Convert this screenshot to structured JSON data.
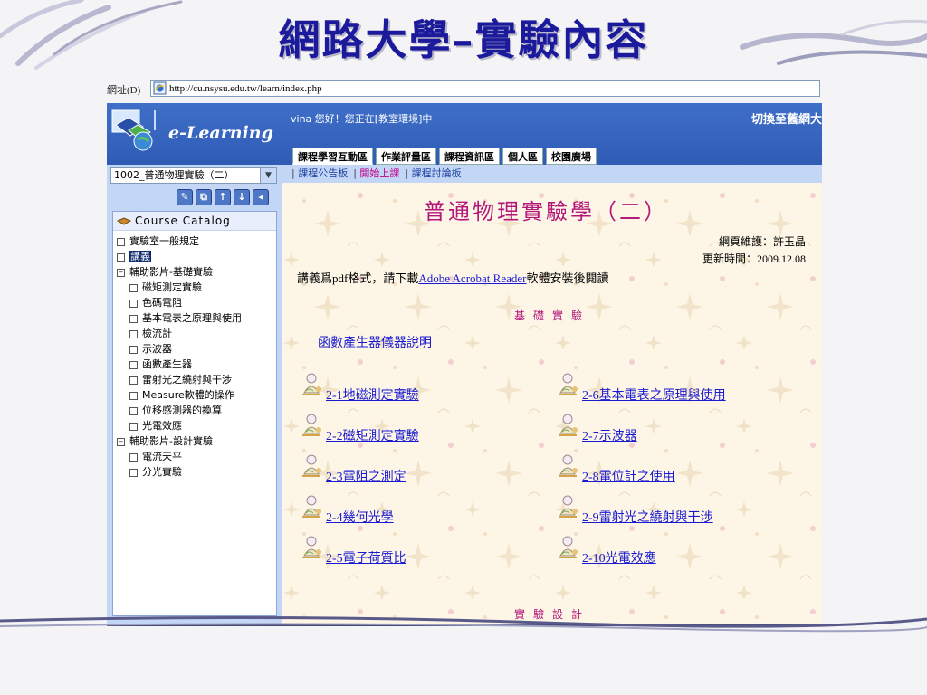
{
  "slide": {
    "title": "網路大學–實驗內容"
  },
  "address_bar": {
    "label": "網址(D)",
    "url": "http://cu.nsysu.edu.tw/learn/index.php"
  },
  "header": {
    "logo_text": "e-Learning",
    "greeting": "vina 您好！您正在[教室環境]中",
    "switch_link": "切換至舊網大",
    "tabs": [
      "課程學習互動區",
      "作業評量區",
      "課程資訊區",
      "個人區",
      "校園廣場"
    ]
  },
  "left_panel": {
    "course_select": "1002_普通物理實驗（二）",
    "toolbar_icons": [
      "pencil-icon",
      "sitemap-icon",
      "arrow-up-icon",
      "arrow-down-icon",
      "arrow-left-icon"
    ],
    "catalog_title": "Course Catalog",
    "tree": [
      {
        "label": "實驗室一般規定",
        "level": 0,
        "marker": "□"
      },
      {
        "label": "講義",
        "level": 0,
        "marker": "□",
        "selected": true
      },
      {
        "label": "輔助影片-基礎實驗",
        "level": 0,
        "marker": "−"
      },
      {
        "label": "磁矩測定實驗",
        "level": 1,
        "marker": "□"
      },
      {
        "label": "色碼電阻",
        "level": 1,
        "marker": "□"
      },
      {
        "label": "基本電表之原理與使用",
        "level": 1,
        "marker": "□"
      },
      {
        "label": "檢流計",
        "level": 1,
        "marker": "□"
      },
      {
        "label": "示波器",
        "level": 1,
        "marker": "□"
      },
      {
        "label": "函數產生器",
        "level": 1,
        "marker": "□"
      },
      {
        "label": "雷射光之繞射與干涉",
        "level": 1,
        "marker": "□"
      },
      {
        "label": "Measure軟體的操作",
        "level": 1,
        "marker": "□"
      },
      {
        "label": "位移感測器的換算",
        "level": 1,
        "marker": "□"
      },
      {
        "label": "光電效應",
        "level": 1,
        "marker": "□"
      },
      {
        "label": "輔助影片-設計實驗",
        "level": 0,
        "marker": "−"
      },
      {
        "label": "電流天平",
        "level": 1,
        "marker": "□"
      },
      {
        "label": "分光實驗",
        "level": 1,
        "marker": "□"
      }
    ]
  },
  "content": {
    "subnav": {
      "sep": "|",
      "items": [
        "課程公告板",
        "開始上課",
        "課程討論板"
      ],
      "active": "開始上課"
    },
    "course_title": "普通物理實驗學（二）",
    "maintainer": "網頁維護：許玉晶",
    "updated": "更新時間：2009.12.08",
    "notice_prefix": "講義爲pdf格式，請下載",
    "notice_link": "Adobe Acrobat Reader",
    "notice_suffix": "軟體安裝後閱讀",
    "section_basic": "基礎實驗",
    "intro_link": "函數產生器儀器說明",
    "experiments_left": [
      "2-1地磁測定實驗",
      "2-2磁矩測定實驗",
      "2-3電阻之測定",
      "2-4幾何光學",
      "2-5電子荷質比"
    ],
    "experiments_right": [
      "2-6基本電表之原理與使用",
      "2-7示波器",
      "2-8電位計之使用",
      "2-9雷射光之繞射與干涉",
      "2-10光電效應"
    ],
    "section_design": "實驗設計"
  },
  "colors": {
    "title": "#1c1a9c",
    "header_blue": "#3f6fc8",
    "panel_blue": "#c4d6f5",
    "accent_magenta": "#b4177a",
    "link": "#1a1ad0",
    "content_bg": "#fdf6e6"
  }
}
